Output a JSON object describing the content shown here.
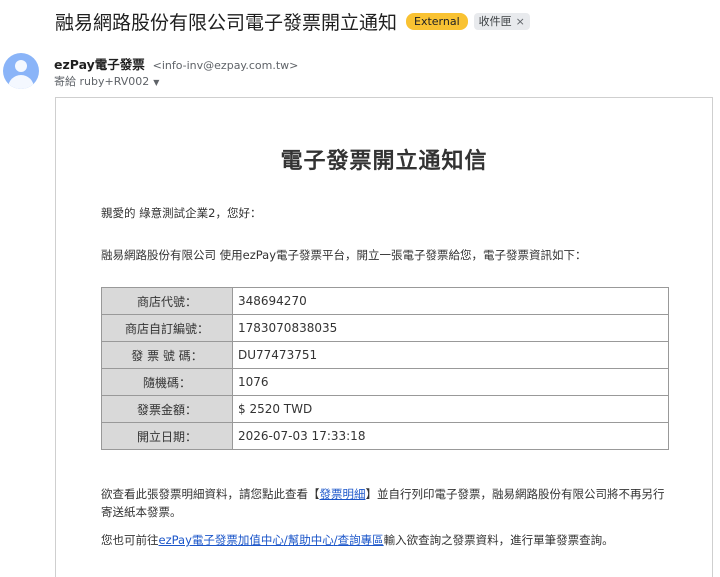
{
  "email": {
    "subject": "融易網路股份有限公司電子發票開立通知",
    "badge_external": "External",
    "inbox_chip": "收件匣",
    "inbox_chip_close": "×",
    "sender_name": "ezPay電子發票",
    "sender_email": "<info-inv@ezpay.com.tw>",
    "to_line": "寄給 ruby+RV002",
    "to_caret": "▼"
  },
  "body": {
    "title": "電子發票開立通知信",
    "greeting": "親愛的 綠意測試企業2，您好：",
    "intro": "融易網路股份有限公司 使用ezPay電子發票平台，開立一張電子發票給您，電子發票資訊如下：",
    "rows": [
      {
        "label": "商店代號：",
        "value": "348694270"
      },
      {
        "label": "商店自訂編號：",
        "value": "1783070838035"
      },
      {
        "label": "發 票 號 碼：",
        "value": "DU77473751"
      },
      {
        "label": "隨機碼：",
        "value": "1076"
      },
      {
        "label": "發票金額：",
        "value": "$ 2520 TWD"
      },
      {
        "label": "開立日期：",
        "value": "2026-07-03 17:33:18"
      }
    ],
    "para1_before": "欲查看此張發票明細資料，請您點此查看【",
    "para1_link": "發票明細",
    "para1_after": "】並自行列印電子發票，融易網路股份有限公司將不再另行寄送紙本發票。",
    "para2_before": "您也可前往",
    "para2_link1": "ezPay電子發票加值中心",
    "para2_sep1": "/",
    "para2_link2": "幫助中心",
    "para2_sep2": "/",
    "para2_link3": "查詢專區",
    "para2_after": "輸入欲查詢之發票資料，進行單筆發票查詢。"
  },
  "colors": {
    "external_badge": "#f9c232",
    "link": "#1a55c9",
    "label_cell_bg": "#d9d9d9",
    "avatar": "#8ab4f8"
  }
}
